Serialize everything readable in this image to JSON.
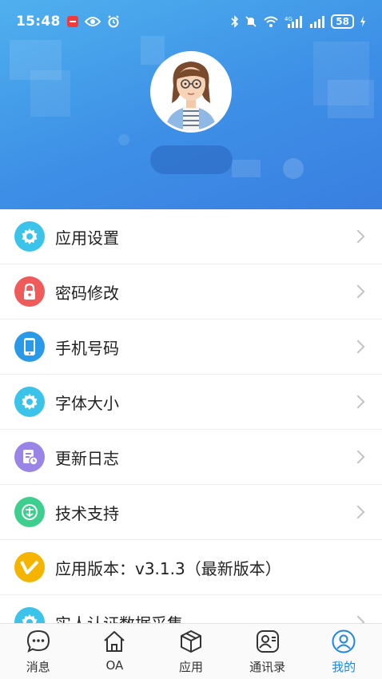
{
  "status_bar": {
    "time": "15:48",
    "battery": "58",
    "network": "4G"
  },
  "menu": {
    "items": [
      {
        "label": "应用设置",
        "icon": "gear-icon",
        "color": "#3cc3ea"
      },
      {
        "label": "密码修改",
        "icon": "lock-icon",
        "color": "#ef5a5a"
      },
      {
        "label": "手机号码",
        "icon": "phone-icon",
        "color": "#2a9ae8"
      },
      {
        "label": "字体大小",
        "icon": "gear-icon",
        "color": "#3cc3ea"
      },
      {
        "label": "更新日志",
        "icon": "log-icon",
        "color": "#9a84e6"
      },
      {
        "label": "技术支持",
        "icon": "support-icon",
        "color": "#3ecf8e"
      },
      {
        "label": "应用版本：v3.1.3（最新版本）",
        "icon": "version-icon",
        "color": "#f4b400"
      },
      {
        "label": "实人认证数据采集",
        "icon": "gear-icon",
        "color": "#3cc3ea"
      }
    ]
  },
  "tabbar": {
    "tabs": [
      {
        "label": "消息",
        "icon": "message-icon"
      },
      {
        "label": "OA",
        "icon": "home-icon"
      },
      {
        "label": "应用",
        "icon": "cube-icon"
      },
      {
        "label": "通讯录",
        "icon": "contacts-icon"
      },
      {
        "label": "我的",
        "icon": "profile-icon",
        "active": true
      }
    ],
    "active_color": "#1f86e8"
  },
  "colors": {
    "header_gradient_start": "#4fb0ee",
    "header_gradient_end": "#3a7fe0"
  }
}
